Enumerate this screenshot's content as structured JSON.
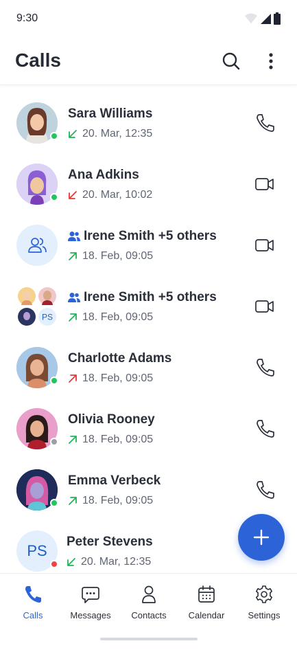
{
  "status_bar": {
    "time": "9:30"
  },
  "app_bar": {
    "title": "Calls"
  },
  "calls": [
    {
      "name": "Sara Williams",
      "time": "20. Mar, 12:35",
      "direction": "incoming",
      "type": "voice",
      "presence": "online",
      "group": false
    },
    {
      "name": "Ana Adkins",
      "time": "20. Mar, 10:02",
      "direction": "missed",
      "type": "video",
      "presence": "online",
      "group": false
    },
    {
      "name": "Irene Smith +5 others",
      "time": "18. Feb, 09:05",
      "direction": "outgoing",
      "type": "video",
      "presence": "none",
      "group": true
    },
    {
      "name": "Irene Smith +5 others",
      "time": "18. Feb, 09:05",
      "direction": "outgoing",
      "type": "video",
      "presence": "none",
      "group": true,
      "collage_initials": "PS"
    },
    {
      "name": "Charlotte Adams",
      "time": "18. Feb, 09:05",
      "direction": "outgoing-missed",
      "type": "voice",
      "presence": "online",
      "group": false
    },
    {
      "name": "Olivia Rooney",
      "time": "18. Feb, 09:05",
      "direction": "outgoing",
      "type": "voice",
      "presence": "offline",
      "group": false
    },
    {
      "name": "Emma Verbeck",
      "time": "18. Feb, 09:05",
      "direction": "outgoing",
      "type": "voice",
      "presence": "online",
      "group": false
    },
    {
      "name": "Peter Stevens",
      "time": "20. Mar, 12:35",
      "direction": "incoming",
      "type": "voice",
      "presence": "busy",
      "group": false,
      "initials": "PS"
    }
  ],
  "fab": {
    "icon": "plus-icon"
  },
  "bottom_nav": [
    {
      "label": "Calls",
      "icon": "phone-icon",
      "active": true
    },
    {
      "label": "Messages",
      "icon": "chat-icon",
      "active": false
    },
    {
      "label": "Contacts",
      "icon": "person-icon",
      "active": false
    },
    {
      "label": "Calendar",
      "icon": "calendar-icon",
      "active": false
    },
    {
      "label": "Settings",
      "icon": "gear-icon",
      "active": false
    }
  ],
  "colors": {
    "accent": "#2c64d8",
    "online": "#22c55e",
    "offline": "#9aa0a8",
    "busy": "#ef4444",
    "incoming_arrow": "#22b35a",
    "missed_arrow": "#e53935"
  }
}
